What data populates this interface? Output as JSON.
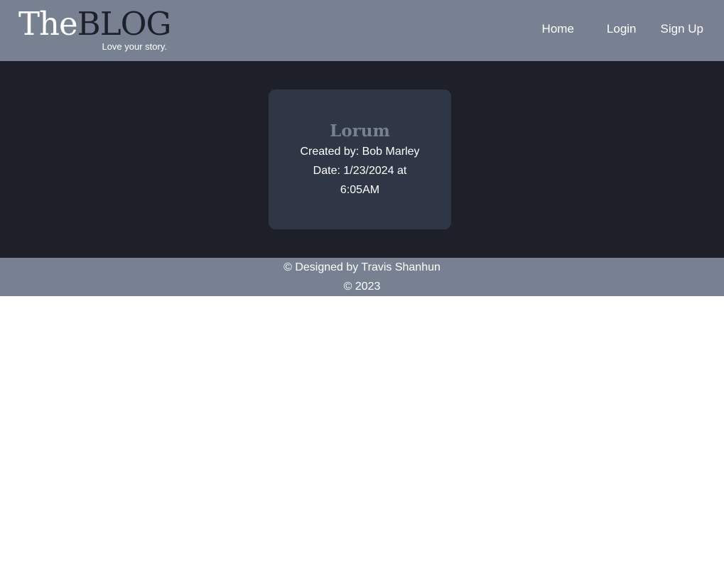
{
  "header": {
    "brand_the": "The",
    "brand_blog": "BLOG",
    "tagline": "Love your story.",
    "nav": {
      "home": "Home",
      "login": "Login",
      "signup": "Sign Up"
    }
  },
  "posts": [
    {
      "title": "Lorum",
      "created_by": "Created by: Bob Marley",
      "date": "Date: 1/23/2024 at 6:05AM"
    }
  ],
  "footer": {
    "line1": "© Designed by Travis Shanhun",
    "line2": "© 2023"
  },
  "colors": {
    "header_bg": "#778191",
    "main_bg": "#1d2029",
    "card_bg": "#2f3646",
    "title_accent": "#778191"
  }
}
